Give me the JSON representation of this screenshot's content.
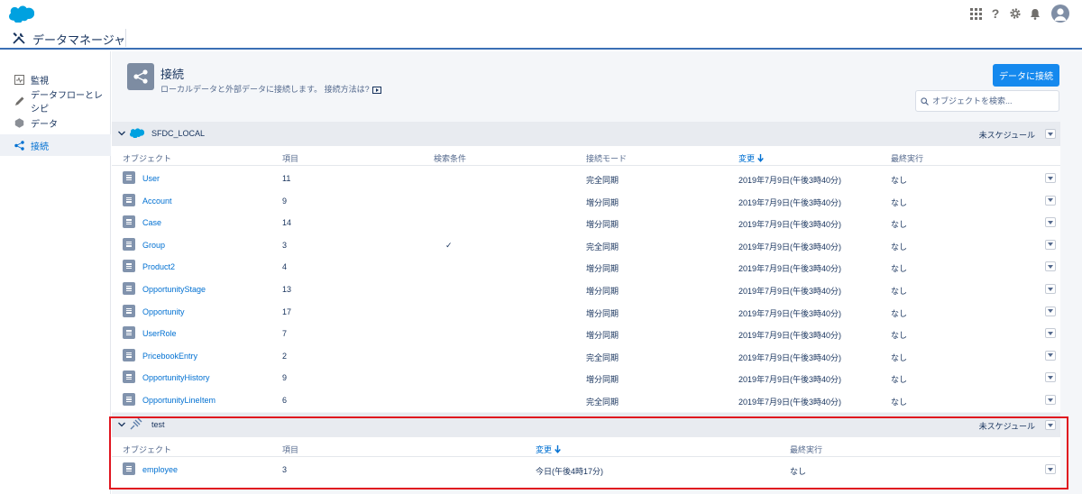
{
  "app": {
    "title": "データマネージャ"
  },
  "sidebar": {
    "items": [
      {
        "label": "監視",
        "icon": "monitor-icon"
      },
      {
        "label": "データフローとレシピ",
        "icon": "pencil-icon"
      },
      {
        "label": "データ",
        "icon": "hexagon-icon"
      },
      {
        "label": "接続",
        "icon": "share-icon"
      }
    ]
  },
  "header": {
    "title": "接続",
    "subtitle": "ローカルデータと外部データに接続します。 接続方法は?",
    "connect_button": "データに接続",
    "search_placeholder": "オブジェクトを検索..."
  },
  "sfdc_section": {
    "name": "SFDC_LOCAL",
    "schedule": "未スケジュール",
    "columns": [
      "オブジェクト",
      "項目",
      "検索条件",
      "接続モード",
      "変更",
      "最終実行"
    ],
    "rows": [
      {
        "object": "User",
        "fields": "11",
        "filter": "",
        "mode": "完全同期",
        "changed": "2019年7月9日(午後3時40分)",
        "last_run": "なし"
      },
      {
        "object": "Account",
        "fields": "9",
        "filter": "",
        "mode": "増分同期",
        "changed": "2019年7月9日(午後3時40分)",
        "last_run": "なし"
      },
      {
        "object": "Case",
        "fields": "14",
        "filter": "",
        "mode": "増分同期",
        "changed": "2019年7月9日(午後3時40分)",
        "last_run": "なし"
      },
      {
        "object": "Group",
        "fields": "3",
        "filter": "✓",
        "mode": "完全同期",
        "changed": "2019年7月9日(午後3時40分)",
        "last_run": "なし"
      },
      {
        "object": "Product2",
        "fields": "4",
        "filter": "",
        "mode": "増分同期",
        "changed": "2019年7月9日(午後3時40分)",
        "last_run": "なし"
      },
      {
        "object": "OpportunityStage",
        "fields": "13",
        "filter": "",
        "mode": "増分同期",
        "changed": "2019年7月9日(午後3時40分)",
        "last_run": "なし"
      },
      {
        "object": "Opportunity",
        "fields": "17",
        "filter": "",
        "mode": "増分同期",
        "changed": "2019年7月9日(午後3時40分)",
        "last_run": "なし"
      },
      {
        "object": "UserRole",
        "fields": "7",
        "filter": "",
        "mode": "増分同期",
        "changed": "2019年7月9日(午後3時40分)",
        "last_run": "なし"
      },
      {
        "object": "PricebookEntry",
        "fields": "2",
        "filter": "",
        "mode": "完全同期",
        "changed": "2019年7月9日(午後3時40分)",
        "last_run": "なし"
      },
      {
        "object": "OpportunityHistory",
        "fields": "9",
        "filter": "",
        "mode": "増分同期",
        "changed": "2019年7月9日(午後3時40分)",
        "last_run": "なし"
      },
      {
        "object": "OpportunityLineItem",
        "fields": "6",
        "filter": "",
        "mode": "完全同期",
        "changed": "2019年7月9日(午後3時40分)",
        "last_run": "なし"
      }
    ]
  },
  "test_section": {
    "name": "test",
    "schedule": "未スケジュール",
    "columns": [
      "オブジェクト",
      "項目",
      "変更",
      "最終実行"
    ],
    "rows": [
      {
        "object": "employee",
        "fields": "3",
        "changed": "今日(午後4時17分)",
        "last_run": "なし"
      }
    ]
  },
  "colors": {
    "accent": "#1589ee",
    "link": "#0070d2",
    "highlight": "#e0151f"
  }
}
